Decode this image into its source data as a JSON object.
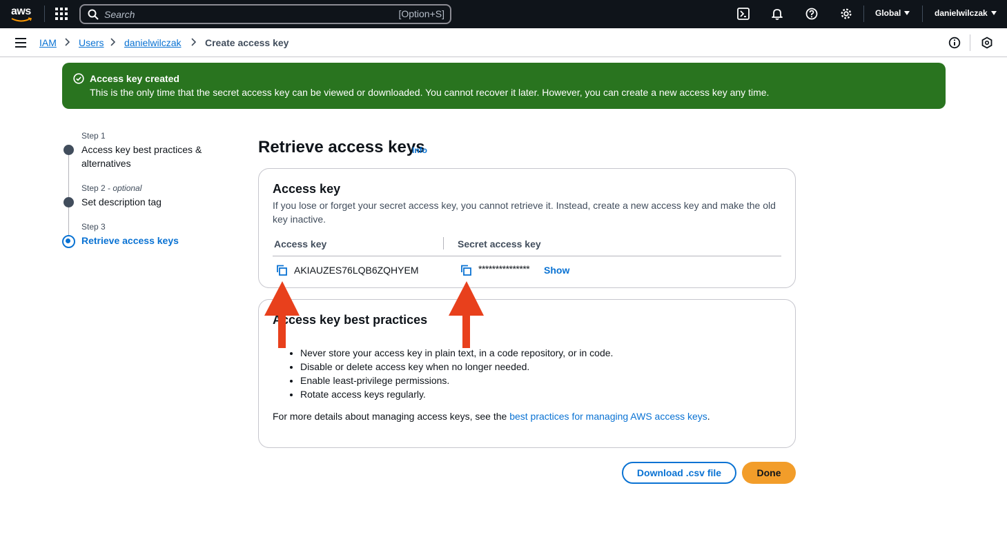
{
  "topnav": {
    "logo_text": "aws",
    "search_placeholder": "Search",
    "search_shortcut": "[Option+S]",
    "region": "Global",
    "user": "danielwilczak"
  },
  "breadcrumb": {
    "items": [
      "IAM",
      "Users",
      "danielwilczak",
      "Create access key"
    ]
  },
  "flash": {
    "title": "Access key created",
    "body": "This is the only time that the secret access key can be viewed or downloaded. You cannot recover it later. However, you can create a new access key any time.",
    "color": "#29741f"
  },
  "steps": [
    {
      "number": "Step 1",
      "optional": "",
      "label": "Access key best practices & alternatives",
      "state": "complete"
    },
    {
      "number": "Step 2 - ",
      "optional": "optional",
      "label": "Set description tag",
      "state": "complete"
    },
    {
      "number": "Step 3",
      "optional": "",
      "label": "Retrieve access keys",
      "state": "active"
    }
  ],
  "main": {
    "title": "Retrieve access keys",
    "info": "Info"
  },
  "access_key_card": {
    "title": "Access key",
    "description": "If you lose or forget your secret access key, you cannot retrieve it. Instead, create a new access key and make the old key inactive.",
    "col_access_key": "Access key",
    "col_secret_key": "Secret access key",
    "access_key_value": "AKIAUZES76LQB6ZQHYEM",
    "secret_key_masked": "***************",
    "show_label": "Show"
  },
  "best_practices_card": {
    "title": "Access key best practices",
    "items": [
      "Never store your access key in plain text, in a code repository, or in code.",
      "Disable or delete access key when no longer needed.",
      "Enable least-privilege permissions.",
      "Rotate access keys regularly."
    ],
    "more_prefix": "For more details about managing access keys, see the ",
    "more_link": "best practices for managing AWS access keys",
    "more_suffix": "."
  },
  "actions": {
    "download": "Download .csv file",
    "done": "Done"
  },
  "colors": {
    "accent": "#0972d3",
    "primary_button": "#f29d2a",
    "annotation_arrow": "#e8401c"
  }
}
